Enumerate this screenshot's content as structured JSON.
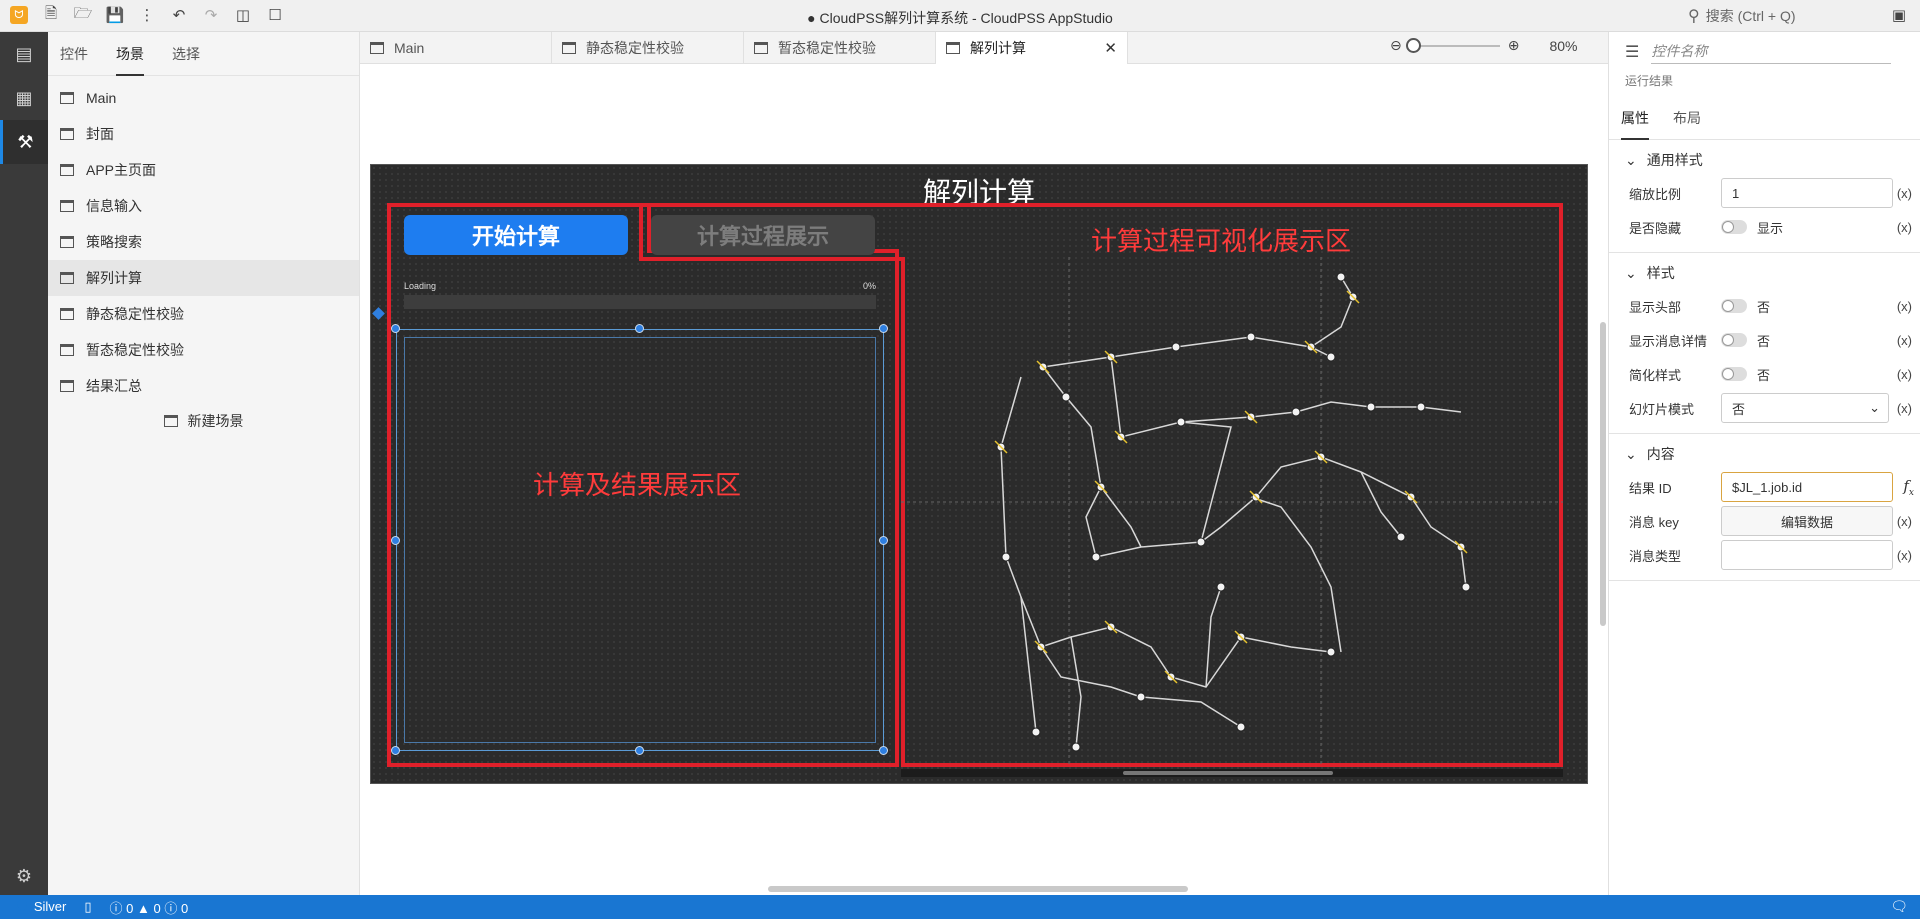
{
  "titlebar": {
    "title": "● CloudPSS解列计算系统 - CloudPSS AppStudio",
    "search_placeholder": "搜索 (Ctrl + Q)",
    "logo": "ᗢ"
  },
  "sidepanel": {
    "tabs": [
      "控件",
      "场景",
      "选择"
    ],
    "scenes": [
      "Main",
      "封面",
      "APP主页面",
      "信息输入",
      "策略搜索",
      "解列计算",
      "静态稳定性校验",
      "暂态稳定性校验",
      "结果汇总"
    ],
    "new_scene": "新建场景"
  },
  "editor_tabs": [
    "Main",
    "静态稳定性校验",
    "暂态稳定性校验",
    "解列计算"
  ],
  "zoom": {
    "value": "80%",
    "level_fraction": 0.0
  },
  "artboard": {
    "title": "解列计算",
    "start_button": "开始计算",
    "process_button": "计算过程展示",
    "left_area_label": "计算及结果展示区",
    "right_area_label": "计算过程可视化展示区",
    "loading_label": "Loading",
    "loading_percent": "0%"
  },
  "props": {
    "control_name_placeholder": "控件名称",
    "subtitle": "运行结果",
    "tabs": [
      "属性",
      "布局"
    ],
    "sections": {
      "common": "通用样式",
      "style": "样式",
      "content": "内容"
    },
    "fields": {
      "scale_label": "缩放比例",
      "scale_value": "1",
      "hidden_label": "是否隐藏",
      "hidden_value": "显示",
      "show_header_label": "显示头部",
      "show_header_value": "否",
      "show_detail_label": "显示消息详情",
      "show_detail_value": "否",
      "simple_label": "简化样式",
      "simple_value": "否",
      "slide_label": "幻灯片模式",
      "slide_value": "否",
      "result_id_label": "结果 ID",
      "result_id_value": "$JL_1.job.id",
      "msg_key_label": "消息 key",
      "msg_key_button": "编辑数据",
      "msg_type_label": "消息类型",
      "msg_type_value": ""
    },
    "x_mark": "(x)"
  },
  "statusbar": {
    "user": "Silver",
    "errors": "0",
    "warnings": "0",
    "infos": "0"
  }
}
